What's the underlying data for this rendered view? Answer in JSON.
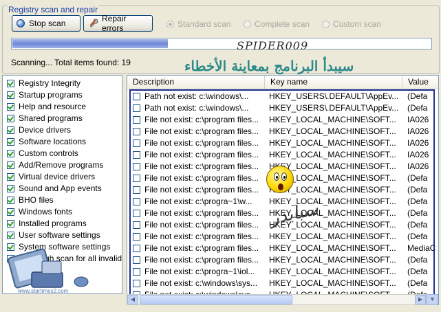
{
  "group": {
    "title": "Registry scan and repair"
  },
  "buttons": {
    "stop": "Stop scan",
    "repair": "Repair errors"
  },
  "scan_modes": [
    {
      "label": "Standard scan",
      "selected": true
    },
    {
      "label": "Complete scan",
      "selected": false
    },
    {
      "label": "Custom scan",
      "selected": false
    }
  ],
  "progress": {
    "fraction": 0.37
  },
  "status": "Scanning... Total items found: 19",
  "watermarks": {
    "brand": "SPIDER009",
    "arabic": "سيبدأ البرنامج بمعاينة الأخطاء",
    "script": "سبايدر",
    "site": "www.startimes2.com"
  },
  "categories": [
    {
      "label": "Registry Integrity",
      "checked": true
    },
    {
      "label": "Startup programs",
      "checked": true
    },
    {
      "label": "Help and resource",
      "checked": true
    },
    {
      "label": "Shared programs",
      "checked": true
    },
    {
      "label": "Device drivers",
      "checked": true
    },
    {
      "label": "Software locations",
      "checked": true
    },
    {
      "label": "Custom controls",
      "checked": true
    },
    {
      "label": "Add/Remove programs",
      "checked": true
    },
    {
      "label": "Virtual device drivers",
      "checked": true
    },
    {
      "label": "Sound and App events",
      "checked": true
    },
    {
      "label": "BHO files",
      "checked": true
    },
    {
      "label": "Windows fonts",
      "checked": true
    },
    {
      "label": "Installed programs",
      "checked": true
    },
    {
      "label": "User software settings",
      "checked": true
    },
    {
      "label": "System software settings",
      "checked": true
    },
    {
      "label": "Thorough scan for all invalid",
      "checked": false
    }
  ],
  "table": {
    "columns": [
      "Description",
      "Key name",
      "Value"
    ],
    "rows": [
      [
        "Path not exist: c:\\windows\\...",
        "HKEY_USERS\\.DEFAULT\\AppEv...",
        "(Defa"
      ],
      [
        "Path not exist: c:\\windows\\...",
        "HKEY_USERS\\.DEFAULT\\AppEv...",
        "(Defa"
      ],
      [
        "File not exist: c:\\program files...",
        "HKEY_LOCAL_MACHINE\\SOFT...",
        "IA026"
      ],
      [
        "File not exist: c:\\program files...",
        "HKEY_LOCAL_MACHINE\\SOFT...",
        "IA026"
      ],
      [
        "File not exist: c:\\program files...",
        "HKEY_LOCAL_MACHINE\\SOFT...",
        "IA026"
      ],
      [
        "File not exist: c:\\program files...",
        "HKEY_LOCAL_MACHINE\\SOFT...",
        "IA026"
      ],
      [
        "File not exist: c:\\program files...",
        "HKEY_LOCAL_MACHINE\\SOFT...",
        "IA026"
      ],
      [
        "File not exist: c:\\program files...",
        "HKEY_LOCAL_MACHINE\\SOFT...",
        "(Defa"
      ],
      [
        "File not exist: c:\\program files...",
        "HKEY_LOCAL_MACHINE\\SOFT...",
        "(Defa"
      ],
      [
        "File not exist: c:\\progra~1\\w...",
        "HKEY_LOCAL_MACHINE\\SOFT...",
        "(Defa"
      ],
      [
        "File not exist: c:\\program files...",
        "HKEY_LOCAL_MACHINE\\SOFT...",
        "(Defa"
      ],
      [
        "File not exist: c:\\program files...",
        "HKEY_LOCAL_MACHINE\\SOFT...",
        "(Defa"
      ],
      [
        "File not exist: c:\\program files...",
        "HKEY_LOCAL_MACHINE\\SOFT...",
        "(Defa"
      ],
      [
        "File not exist: c:\\program files...",
        "HKEY_LOCAL_MACHINE\\SOFT...",
        "MediaC"
      ],
      [
        "File not exist: c:\\program files...",
        "HKEY_LOCAL_MACHINE\\SOFT...",
        "(Defa"
      ],
      [
        "File not exist: c:\\progra~1\\iol...",
        "HKEY_LOCAL_MACHINE\\SOFT...",
        "(Defa"
      ],
      [
        "File not exist: c:\\windows\\sys...",
        "HKEY_LOCAL_MACHINE\\SOFT...",
        "(Defa"
      ],
      [
        "File not exist: c:\\windows\\sys...",
        "HKEY_LOCAL_MACHINE\\SOFT...",
        "(Defa"
      ]
    ]
  },
  "colors": {
    "accent": "#1a3ea8",
    "progress": "#6f86d6",
    "frame": "#1d2f8f"
  }
}
